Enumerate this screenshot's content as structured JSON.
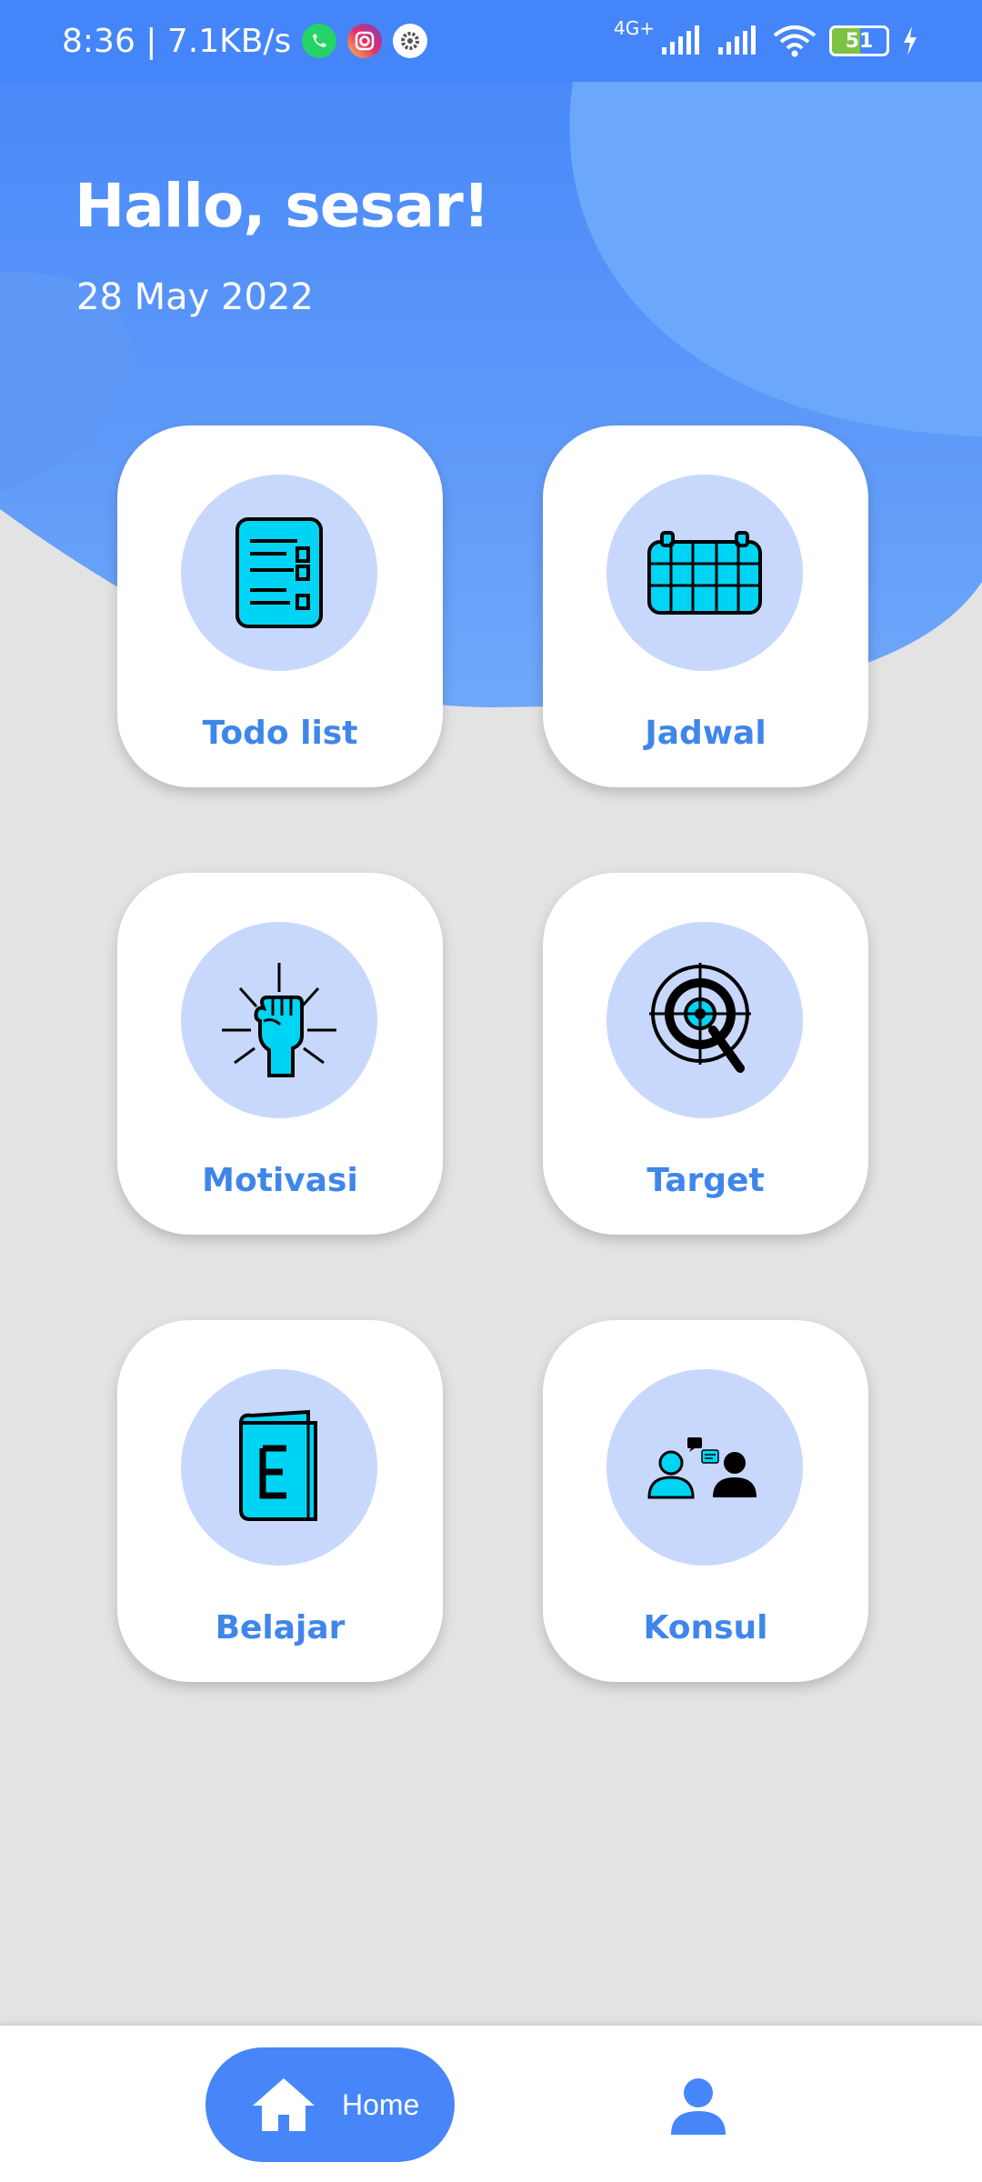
{
  "status_bar": {
    "time_speed": "8:36 | 7.1KB/s",
    "network_label": "4G+",
    "battery_level": "51",
    "battery_fraction": 0.51,
    "icons": [
      "whatsapp-icon",
      "instagram-icon",
      "settings-icon",
      "signal-icon",
      "signal-icon",
      "wifi-icon",
      "battery-icon",
      "charging-icon"
    ]
  },
  "header": {
    "greeting": "Hallo, sesar!",
    "date": "28 May 2022"
  },
  "menu": [
    {
      "label": "Todo list",
      "icon": "todo-list-icon"
    },
    {
      "label": "Jadwal",
      "icon": "calendar-icon"
    },
    {
      "label": "Motivasi",
      "icon": "raised-fist-icon"
    },
    {
      "label": "Target",
      "icon": "target-search-icon"
    },
    {
      "label": "Belajar",
      "icon": "book-icon"
    },
    {
      "label": "Konsul",
      "icon": "consultation-icon"
    }
  ],
  "bottom_nav": {
    "home_label": "Home",
    "icons": [
      "home-icon",
      "profile-icon"
    ]
  },
  "colors": {
    "header_blue": "#4485f9",
    "accent_blue": "#3f86ea",
    "icon_cyan": "#00d4f5",
    "icon_circle": "#c8d8fd",
    "background": "#e3e3e3"
  }
}
